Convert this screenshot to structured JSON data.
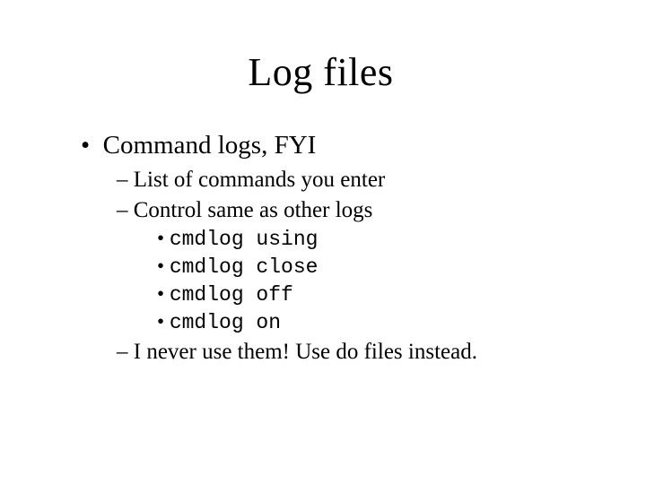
{
  "title": "Log files",
  "lvl1": {
    "0": "Command logs, FYI"
  },
  "lvl2": {
    "0": "List of commands you enter",
    "1": "Control same as other logs",
    "2": "I never use them!  Use do files instead."
  },
  "lvl3": {
    "0": "cmdlog using",
    "1": "cmdlog close",
    "2": "cmdlog off",
    "3": "cmdlog on"
  }
}
